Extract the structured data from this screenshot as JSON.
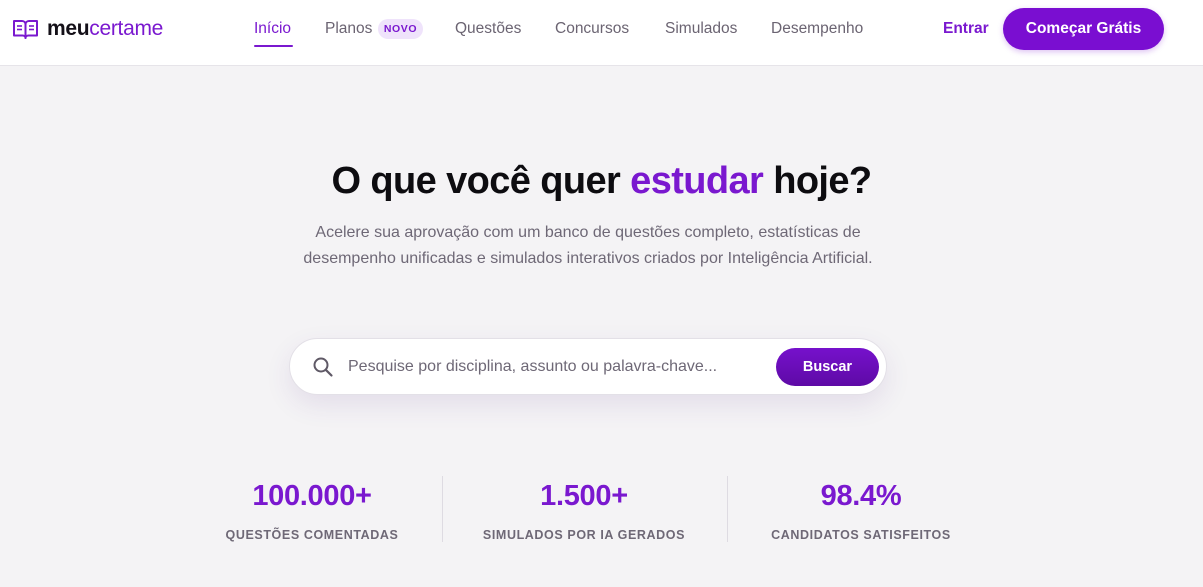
{
  "header": {
    "logo": {
      "part1": "meu",
      "part2": "certame",
      "icon": "open-book-icon"
    },
    "nav": [
      {
        "label": "Início",
        "active": true
      },
      {
        "label": "Planos",
        "badge": "NOVO"
      },
      {
        "label": "Questões"
      },
      {
        "label": "Concursos"
      },
      {
        "label": "Simulados"
      },
      {
        "label": "Desempenho"
      }
    ],
    "login_label": "Entrar",
    "cta_label": "Começar Grátis"
  },
  "hero": {
    "title_before": "O que você quer ",
    "title_highlight": "estudar",
    "title_after": " hoje?",
    "subtitle": "Acelere sua aprovação com um banco de questões completo, estatísticas de desempenho unificadas e simulados interativos criados por Inteligência Artificial."
  },
  "search": {
    "icon": "search-icon",
    "placeholder": "Pesquise por disciplina, assunto ou palavra-chave...",
    "value": "",
    "button_label": "Buscar"
  },
  "stats": [
    {
      "value": "100.000+",
      "label": "QUESTÕES COMENTADAS"
    },
    {
      "value": "1.500+",
      "label": "SIMULADOS POR IA GERADOS"
    },
    {
      "value": "98.4%",
      "label": "CANDIDATOS SATISFEITOS"
    }
  ],
  "colors": {
    "brand": "#7a18cf",
    "background": "#f4f3f5",
    "text_muted": "#6e6876"
  }
}
